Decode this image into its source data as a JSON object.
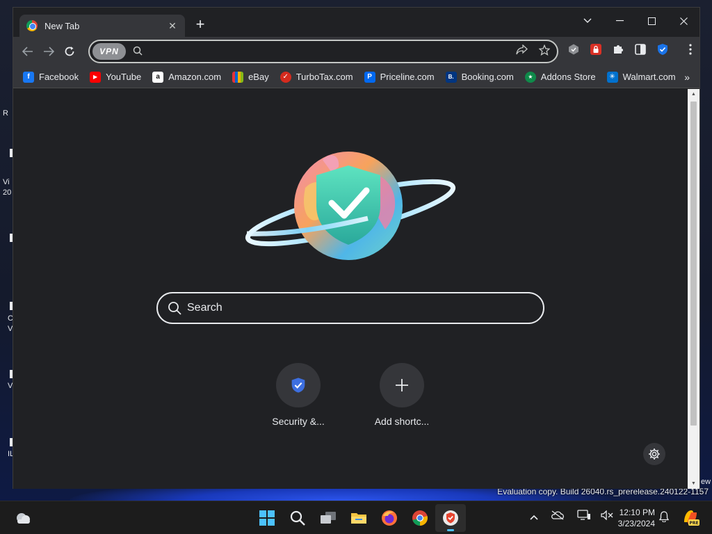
{
  "browser": {
    "tab": {
      "title": "New Tab",
      "close_icon": "close-icon"
    },
    "new_tab_label": "+",
    "window_controls": {
      "dropdown": "⌄",
      "minimize": "—",
      "maximize": "☐",
      "close": "✕"
    },
    "toolbar": {
      "back": "←",
      "forward": "→",
      "reload": "⟳",
      "vpn_label": "VPN",
      "address_value": "",
      "share": "⇗",
      "bookmark_star": "☆",
      "menu": "⋮"
    },
    "extensions": [
      {
        "name": "shield-extension-icon",
        "glyph": "⬢",
        "color": "#8e9094"
      },
      {
        "name": "lock-extension-icon",
        "glyph": "🔒",
        "color": "#d93025"
      },
      {
        "name": "puzzle-extensions-icon",
        "glyph": "✚",
        "color": "#e8eaed"
      },
      {
        "name": "side-panel-icon",
        "glyph": "◧",
        "color": "#e8eaed"
      },
      {
        "name": "security-extension-icon",
        "glyph": "✔",
        "color": "#1a73e8"
      }
    ],
    "bookmarks": [
      {
        "label": "Facebook",
        "icon": "f",
        "color": "#1877f2"
      },
      {
        "label": "YouTube",
        "icon": "▶",
        "color": "#ff0000"
      },
      {
        "label": "Amazon.com",
        "icon": "a",
        "color": "#ffffff"
      },
      {
        "label": "eBay",
        "icon": "e",
        "color": "#e53238"
      },
      {
        "label": "TurboTax.com",
        "icon": "✓",
        "color": "#d52b1e"
      },
      {
        "label": "Priceline.com",
        "icon": "P",
        "color": "#0068ef"
      },
      {
        "label": "Booking.com",
        "icon": "B.",
        "color": "#003580"
      },
      {
        "label": "Addons Store",
        "icon": "★",
        "color": "#0f8a4a"
      },
      {
        "label": "Walmart.com",
        "icon": "✳",
        "color": "#0071ce"
      }
    ],
    "bookmarks_more": "»"
  },
  "newtab": {
    "search_placeholder": "Search",
    "shortcuts": [
      {
        "label": "Security &..."
      },
      {
        "label": "Add shortc..."
      }
    ]
  },
  "desktop": {
    "eval_text": "Evaluation copy. Build 26040.rs_prerelease.240122-1157",
    "fragments": [
      "R",
      "Vi",
      "20",
      "C",
      "V",
      "V",
      "IL",
      "ew"
    ]
  },
  "taskbar": {
    "time": "12:10 PM",
    "date": "3/23/2024",
    "apps": [
      "start-icon",
      "search-icon",
      "task-view-icon",
      "file-explorer-icon",
      "firefox-icon",
      "chrome-icon",
      "shield-browser-icon"
    ]
  }
}
